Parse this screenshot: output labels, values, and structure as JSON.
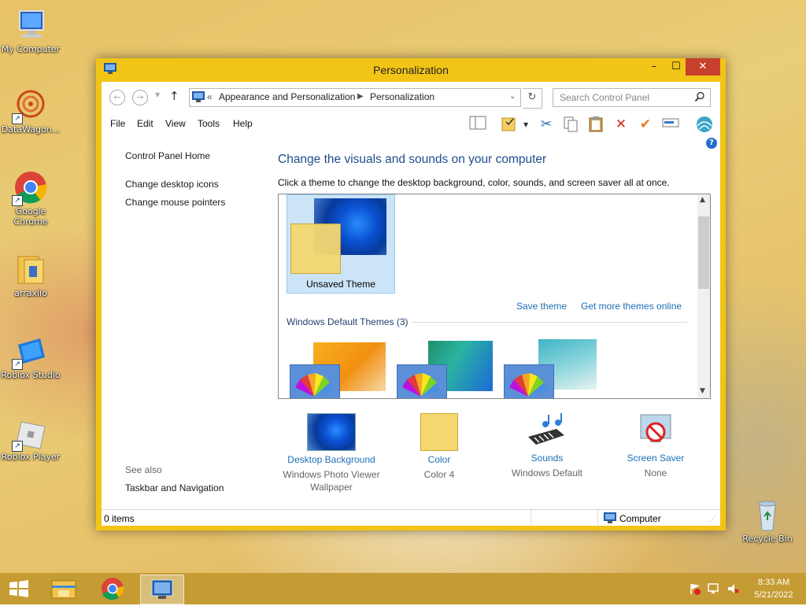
{
  "desktop": {
    "icons": [
      {
        "label": "My Computer",
        "icon": "computer-icon"
      },
      {
        "label": "DataWagon...",
        "icon": "datawagon-icon"
      },
      {
        "label": "Google Chrome",
        "icon": "chrome-icon"
      },
      {
        "label": "arraxiio",
        "icon": "folder-icon"
      },
      {
        "label": "Roblox Studio",
        "icon": "roblox-studio-icon"
      },
      {
        "label": "Roblox Player",
        "icon": "roblox-player-icon"
      },
      {
        "label": "Recycle Bin",
        "icon": "recycle-bin-icon"
      }
    ]
  },
  "window": {
    "title": "Personalization",
    "controls": {
      "minimize": "–",
      "maximize": "☐",
      "close": "✕"
    }
  },
  "address": {
    "prefix": "«",
    "crumbs": [
      "Appearance and Personalization",
      "Personalization"
    ],
    "search_placeholder": "Search Control Panel"
  },
  "menu": [
    "File",
    "Edit",
    "View",
    "Tools",
    "Help"
  ],
  "left_pane": {
    "home": "Control Panel Home",
    "links": [
      "Change desktop icons",
      "Change mouse pointers"
    ],
    "see_also": "See also",
    "see_also_links": [
      "Taskbar and Navigation"
    ]
  },
  "main": {
    "heading": "Change the visuals and sounds on your computer",
    "subheading": "Click a theme to change the desktop background, color, sounds, and screen saver all at once.",
    "current_theme": "Unsaved Theme",
    "save_theme": "Save theme",
    "get_more": "Get more themes online",
    "group_label": "Windows Default Themes (3)"
  },
  "bottom": [
    {
      "label": "Desktop Background",
      "value": "Windows Photo Viewer Wallpaper"
    },
    {
      "label": "Color",
      "value": "Color 4"
    },
    {
      "label": "Sounds",
      "value": "Windows Default"
    },
    {
      "label": "Screen Saver",
      "value": "None"
    }
  ],
  "status": {
    "items": "0 items",
    "location": "Computer"
  },
  "taskbar": {
    "time": "8:33 AM",
    "date": "5/21/2022"
  },
  "colors": {
    "accent": "#f2c416",
    "link": "#1f6fb8",
    "heading": "#1f4e8c"
  }
}
